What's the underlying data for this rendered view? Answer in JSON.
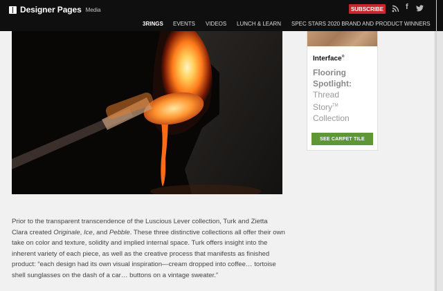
{
  "header": {
    "brand": "Designer Pages",
    "brand_sub": "Media",
    "subscribe_label": "SUBSCRIBE",
    "social_icons": [
      "rss-icon",
      "facebook-icon",
      "twitter-icon"
    ],
    "nav": [
      "3RINGS",
      "EVENTS",
      "VIDEOS",
      "LUNCH & LEARN",
      "SPEC STARS 2020 BRAND AND PRODUCT WINNERS"
    ]
  },
  "ad": {
    "brand": "Interface",
    "title_line1": "Flooring",
    "title_line2": "Spotlight:",
    "sub_line1": "Thread",
    "sub_line2": "Story",
    "sub_tm": "TM",
    "sub_line3": "Collection",
    "cta": "SEE CARPET TILE",
    "cta_color": "#5e9638"
  },
  "article": {
    "p1_a": "Prior to the transparent transcendence of the Luscious Lever collection, Turk and Zietta Clara created ",
    "p1_i1": "Originale",
    "p1_b": ", ",
    "p1_i2": "Ice",
    "p1_c": ", and ",
    "p1_i3": "Pebble",
    "p1_d": ". These three distinctive collections all offer their own take on color and texture, solidity and implied internal space. Turk offers insight into the inherent variety of each piece, as well as the creative process that manifests as finished product: “each design had its own visual inspiration—cream dropped into coffee… tortoise shell sunglasses on the dash of a car… buttons on a vintage sweater.”"
  },
  "colors": {
    "topbar": "#0f0f0f",
    "subscribe": "#c7262f"
  }
}
